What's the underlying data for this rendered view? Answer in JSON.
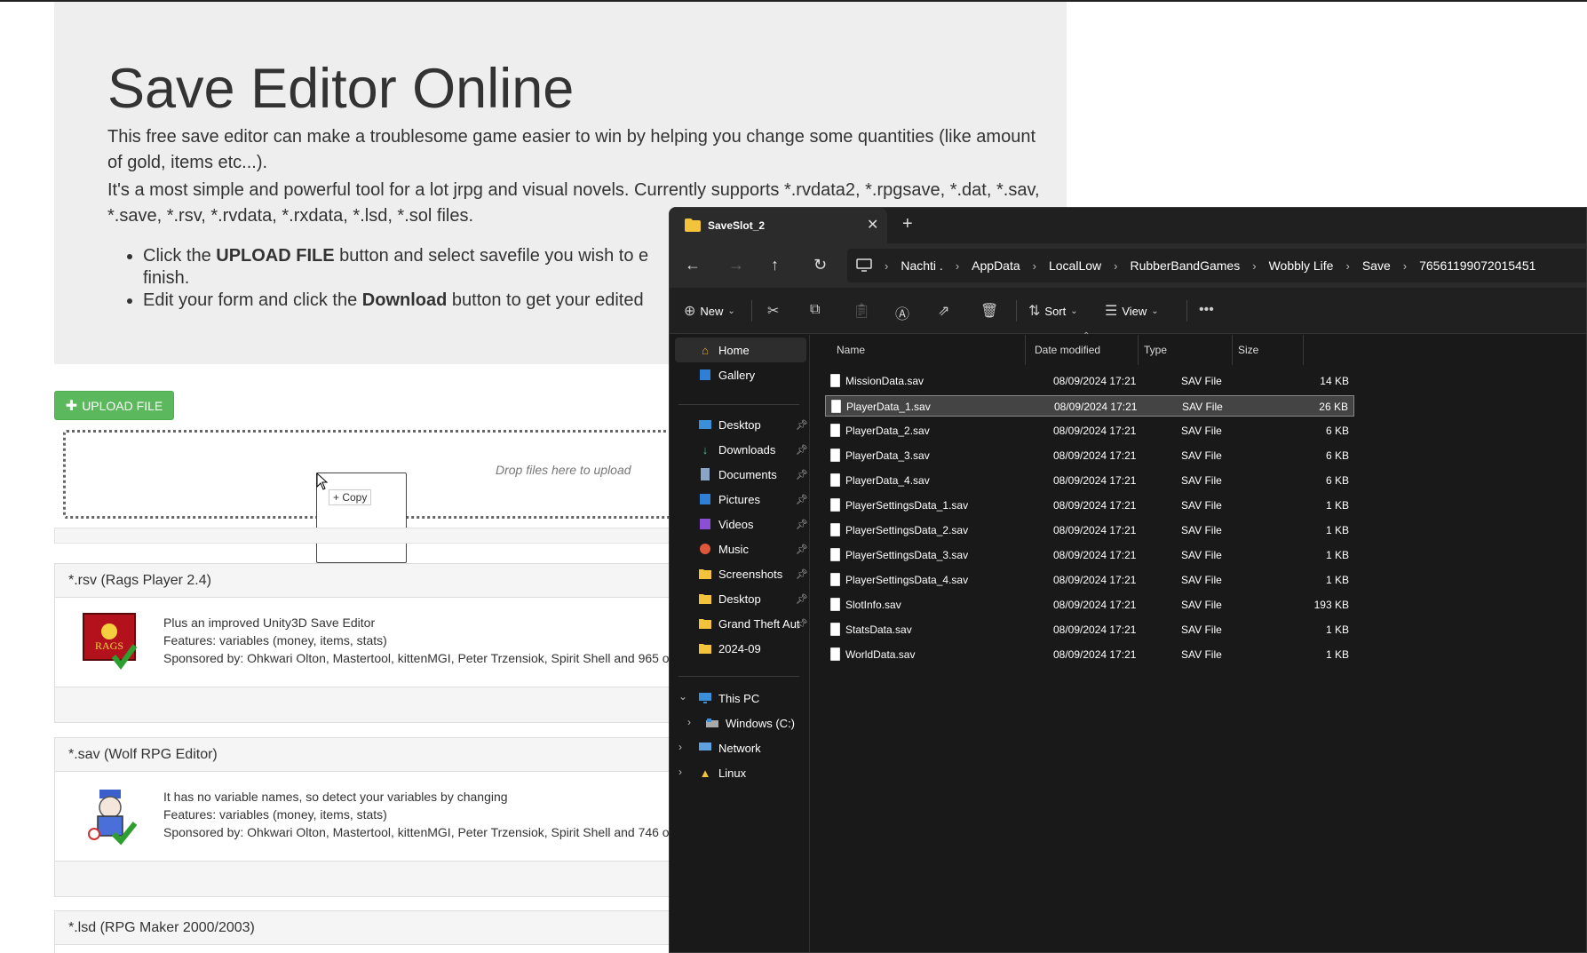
{
  "page": {
    "title": "Save Editor Online",
    "intro1": "This free save editor can make a troublesome game easier to win by helping you change some quantities (like amount of gold, items etc...).",
    "intro2": "It's a most simple and powerful tool for a lot jrpg and visual novels. Currently supports *.rvdata2, *.rpgsave, *.dat, *.sav, *.save, *.rsv, *.rvdata, *.rxdata, *.lsd, *.sol files.",
    "bullet1_pre": "Click the ",
    "bullet1_bold": "UPLOAD FILE",
    "bullet1_post": " button and select savefile you wish to e",
    "bullet1_line2": "finish.",
    "bullet2_pre": "Edit your form and click the ",
    "bullet2_bold": "Download",
    "bullet2_post": " button to get your edited",
    "upload_label": "UPLOAD FILE",
    "drop_hint": "Drop files here to upload",
    "drag_copy": "+ Copy"
  },
  "panels": [
    {
      "header": "*.rsv (Rags Player 2.4)",
      "line1": "Plus an improved Unity3D Save Editor",
      "line2": "Features: variables (money, items, stats)",
      "line3": "Sponsored by: Ohkwari Olton, Mastertool, kittenMGI, Peter Trzensiok, Spirit Shell and 965 o",
      "logo_text": "RAGS"
    },
    {
      "header": "*.sav (Wolf RPG Editor)",
      "line1": "It has no variable names, so detect your variables by changing",
      "line2": "Features: variables (money, items, stats)",
      "line3": "Sponsored by: Ohkwari Olton, Mastertool, kittenMGI, Peter Trzensiok, Spirit Shell and 746 o"
    },
    {
      "header": "*.lsd (RPG Maker 2000/2003)"
    }
  ],
  "explorer": {
    "tab_title": "SaveSlot_2",
    "breadcrumbs": [
      "Nachti .",
      "AppData",
      "LocalLow",
      "RubberBandGames",
      "Wobbly Life",
      "Save",
      "76561199072015451"
    ],
    "commands": {
      "new": "New",
      "sort": "Sort",
      "view": "View"
    },
    "sidebar": {
      "home": "Home",
      "gallery": "Gallery",
      "desktop": "Desktop",
      "downloads": "Downloads",
      "documents": "Documents",
      "pictures": "Pictures",
      "videos": "Videos",
      "music": "Music",
      "screenshots": "Screenshots",
      "desktop2": "Desktop",
      "gta": "Grand Theft Aut",
      "folder2024": "2024-09",
      "thispc": "This PC",
      "windows": "Windows (C:)",
      "network": "Network",
      "linux": "Linux"
    },
    "columns": {
      "name": "Name",
      "date": "Date modified",
      "type": "Type",
      "size": "Size"
    },
    "files": [
      {
        "name": "MissionData.sav",
        "date": "08/09/2024 17:21",
        "type": "SAV File",
        "size": "14 KB"
      },
      {
        "name": "PlayerData_1.sav",
        "date": "08/09/2024 17:21",
        "type": "SAV File",
        "size": "26 KB"
      },
      {
        "name": "PlayerData_2.sav",
        "date": "08/09/2024 17:21",
        "type": "SAV File",
        "size": "6 KB"
      },
      {
        "name": "PlayerData_3.sav",
        "date": "08/09/2024 17:21",
        "type": "SAV File",
        "size": "6 KB"
      },
      {
        "name": "PlayerData_4.sav",
        "date": "08/09/2024 17:21",
        "type": "SAV File",
        "size": "6 KB"
      },
      {
        "name": "PlayerSettingsData_1.sav",
        "date": "08/09/2024 17:21",
        "type": "SAV File",
        "size": "1 KB"
      },
      {
        "name": "PlayerSettingsData_2.sav",
        "date": "08/09/2024 17:21",
        "type": "SAV File",
        "size": "1 KB"
      },
      {
        "name": "PlayerSettingsData_3.sav",
        "date": "08/09/2024 17:21",
        "type": "SAV File",
        "size": "1 KB"
      },
      {
        "name": "PlayerSettingsData_4.sav",
        "date": "08/09/2024 17:21",
        "type": "SAV File",
        "size": "1 KB"
      },
      {
        "name": "SlotInfo.sav",
        "date": "08/09/2024 17:21",
        "type": "SAV File",
        "size": "193 KB"
      },
      {
        "name": "StatsData.sav",
        "date": "08/09/2024 17:21",
        "type": "SAV File",
        "size": "1 KB"
      },
      {
        "name": "WorldData.sav",
        "date": "08/09/2024 17:21",
        "type": "SAV File",
        "size": "1 KB"
      }
    ]
  }
}
